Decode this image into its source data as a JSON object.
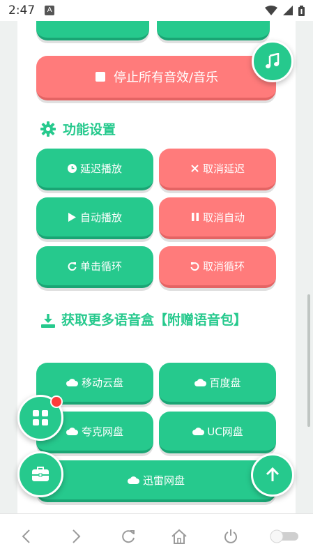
{
  "status": {
    "time": "2:47",
    "a_icon": "A"
  },
  "controls": {
    "stop_label": "停止所有音效/音乐"
  },
  "features": {
    "title": "功能设置",
    "delay_play": "延迟播放",
    "cancel_delay": "取消延迟",
    "auto_play": "自动播放",
    "cancel_auto": "取消自动",
    "single_loop": "单击循环",
    "cancel_loop": "取消循环"
  },
  "downloads": {
    "title": "获取更多语音盒【附赠语音包】",
    "mobile_cloud": "移动云盘",
    "baidu": "百度盘",
    "quark": "夸克网盘",
    "uc": "UC网盘",
    "xunlei": "迅雷网盘"
  },
  "colors": {
    "accent": "#26c98d",
    "danger": "#ff7b7b"
  }
}
